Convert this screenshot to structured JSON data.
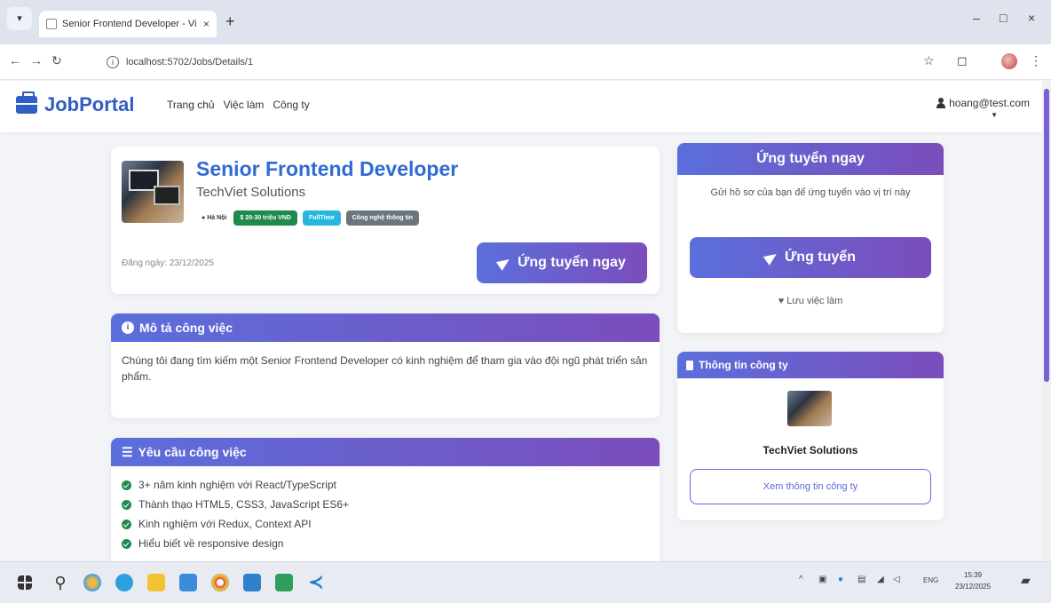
{
  "browser": {
    "tab_title": "Senior Frontend Developer - Vi",
    "tab_close": "×",
    "new_tab": "+",
    "url": "localhost:5702/Jobs/Details/1",
    "minimize": "–",
    "maximize": "□",
    "close": "×"
  },
  "site": {
    "brand": "JobPortal",
    "nav": [
      "Trang chủ",
      "Việc làm",
      "Công ty"
    ],
    "user_email": "hoang@test.com"
  },
  "job": {
    "title": "Senior Frontend Developer",
    "company": "TechViet Solutions",
    "location": "Hà Nội",
    "salary": "$ 20-30 triệu VND",
    "type": "FullTime",
    "category": "Công nghệ thông tin",
    "posted": "Đăng ngày: 23/12/2025",
    "apply_label": "Ứng tuyển ngay"
  },
  "description": {
    "heading": "Mô tả công việc",
    "text": "Chúng tôi đang tìm kiếm một Senior Frontend Developer có kinh nghiệm để tham gia vào đội ngũ phát triển sản phẩm."
  },
  "requirements": {
    "heading": "Yêu cầu công việc",
    "items": [
      "3+ năm kinh nghiệm với React/TypeScript",
      "Thành thạo HTML5, CSS3, JavaScript ES6+",
      "Kinh nghiệm với Redux, Context API",
      "Hiểu biết về responsive design"
    ]
  },
  "apply_panel": {
    "heading": "Ứng tuyển ngay",
    "text": "Gửi hồ sơ của bạn để ứng tuyển vào vị trí này",
    "button": "Ứng tuyển",
    "save": "Lưu việc làm"
  },
  "company_panel": {
    "heading": "Thông tin công ty",
    "name": "TechViet Solutions",
    "button": "Xem thông tin công ty"
  },
  "taskbar": {
    "lang": "ENG",
    "time": "15:39",
    "date": "23/12/2025"
  },
  "colors": {
    "brand": "#2f5ec4",
    "gradient_start": "#5b6fdc",
    "gradient_end": "#7b4dbb",
    "salary_badge": "#1f8a4c",
    "type_badge": "#27b6e0",
    "category_badge": "#6c757d"
  }
}
